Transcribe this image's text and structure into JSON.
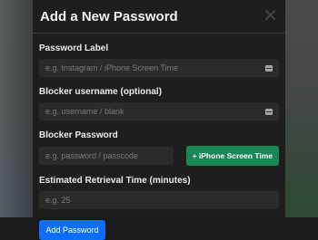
{
  "modal": {
    "title": "Add a New Password",
    "close_glyph": "✕",
    "fields": {
      "label": {
        "label": "Password Label",
        "placeholder": "e.g. Instagram / iPhone Screen Time"
      },
      "blocker_username": {
        "label": "Blocker username (optional)",
        "placeholder": "e.g. username / blank"
      },
      "blocker_password": {
        "label": "Blocker Password",
        "placeholder": "e.g. password / passcode",
        "preset_button": "+ iPhone Screen Time"
      },
      "retrieval_time": {
        "label": "Estimated Retrieval Time (minutes)",
        "placeholder": "e.g. 25"
      }
    },
    "submit_label": "Add Password"
  },
  "icons": {
    "close": "close-icon",
    "password_manager": "key-icon"
  },
  "colors": {
    "modal_bg": "#1e1e1e",
    "input_bg": "#2b2b2b",
    "primary": "#0d6efd",
    "success": "#198754"
  }
}
